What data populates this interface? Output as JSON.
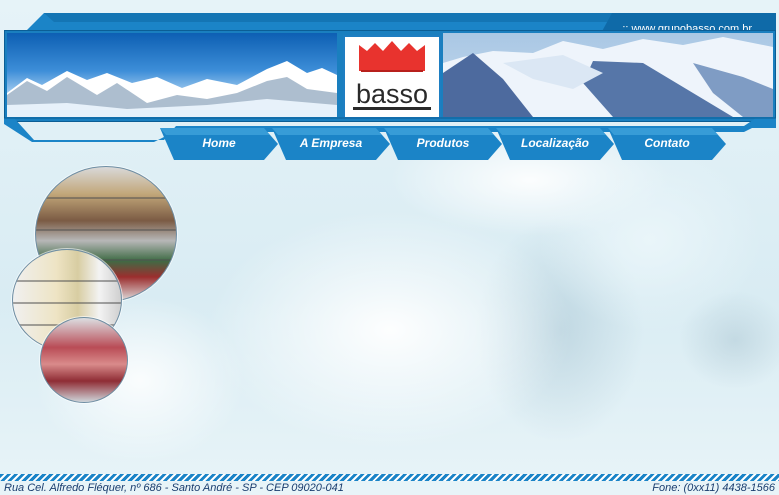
{
  "header": {
    "url_text": ":: www.grupobasso.com.br",
    "logo_text": "basso"
  },
  "nav": {
    "items": [
      {
        "label": "Home"
      },
      {
        "label": "A Empresa"
      },
      {
        "label": "Produtos"
      },
      {
        "label": "Localização"
      },
      {
        "label": "Contato"
      }
    ]
  },
  "footer": {
    "address": "Rua Cel. Alfredo Fléquer, nº 686 - Santo André - SP - CEP 09020-041",
    "phone": "Fone: (0xx11) 4438-1566"
  },
  "colors": {
    "accent": "#1b84c7",
    "dark_accent": "#0b5e95",
    "logo_red": "#e8332e",
    "footer_text": "#1a3d6e"
  }
}
